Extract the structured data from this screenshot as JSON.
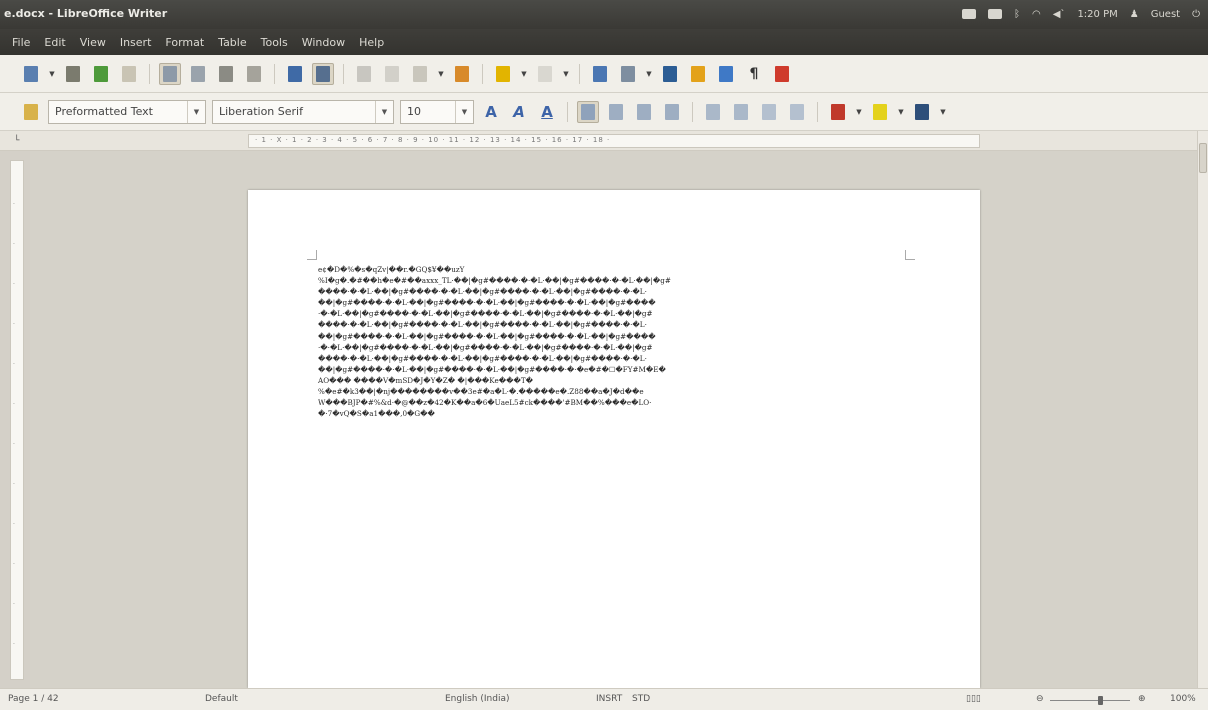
{
  "window": {
    "title": "e.docx - LibreOffice Writer"
  },
  "panel": {
    "time": "1:20 PM",
    "user": "Guest"
  },
  "menu": [
    "File",
    "Edit",
    "View",
    "Insert",
    "Format",
    "Table",
    "Tools",
    "Window",
    "Help"
  ],
  "toolbar2": {
    "paragraph_style": "Preformatted Text",
    "font_name": "Liberation Serif",
    "font_size": "10"
  },
  "ruler": {
    "marks": "· 1 · X · 1 · 2 · 3 · 4 · 5 · 6 · 7 · 8 · 9 · 10 · 11 · 12 · 13 · 14 · 15 · 16 · 17 · 18 ·"
  },
  "document": {
    "lines": [
      "e¢�D�%�s�qZv|��r.�GQ$¥��uzY",
      "%I�g�.�#��h�e�#��axxx_TL·��|�g#����·�·�L·��|�g#����·�·�L·��|�g#",
      "����·�·�L·��|�g#����·�·�L·��|�g#����·�·�L·��|�g#����·�·�L·",
      "��|�g#����·�·�L·��|�g#����·�·�L·��|�g#����·�·�L·��|�g#����",
      "·�·�L·��|�g#����·�·�L·��|�g#����·�·�L·��|�g#����·�·�L·��|�g#",
      "����·�·�L·��|�g#����·�·�L·��|�g#����·�·�L·��|�g#����·�·�L·",
      "��|�g#����·�·�L·��|�g#����·�·�L·��|�g#����·�·�L·��|�g#����",
      "·�·�L·��|�g#����·�·�L·��|�g#����·�·�L·��|�g#����·�·�L·��|�g#",
      "����·�·�L·��|�g#����·�·�L·��|�g#����·�·�L·��|�g#����·�·�L·",
      "��|�g#����·�·�L·��|�g#����·�·�L·��|�g#����·�·�e�#�☐�FY#M�E�",
      "AO��� ����V�mSD�J�Y�Z�      �|���Ke���T�",
      "%�e#�k3��|�nj��������v��3e#�a�L·�.�����e�.Z88��a�J�d��e",
      "W���BJP�#%&d·�@��z�42�K��a�6�UaeL5#ck����'#BM��%���e�LO·",
      "�·7�vQ�S�a1���,0�G��"
    ]
  },
  "statusbar": {
    "page": "Page 1 / 42",
    "style": "Default",
    "language": "English (India)",
    "mode": "INSRT",
    "sel": "STD",
    "zoom": "100%"
  }
}
